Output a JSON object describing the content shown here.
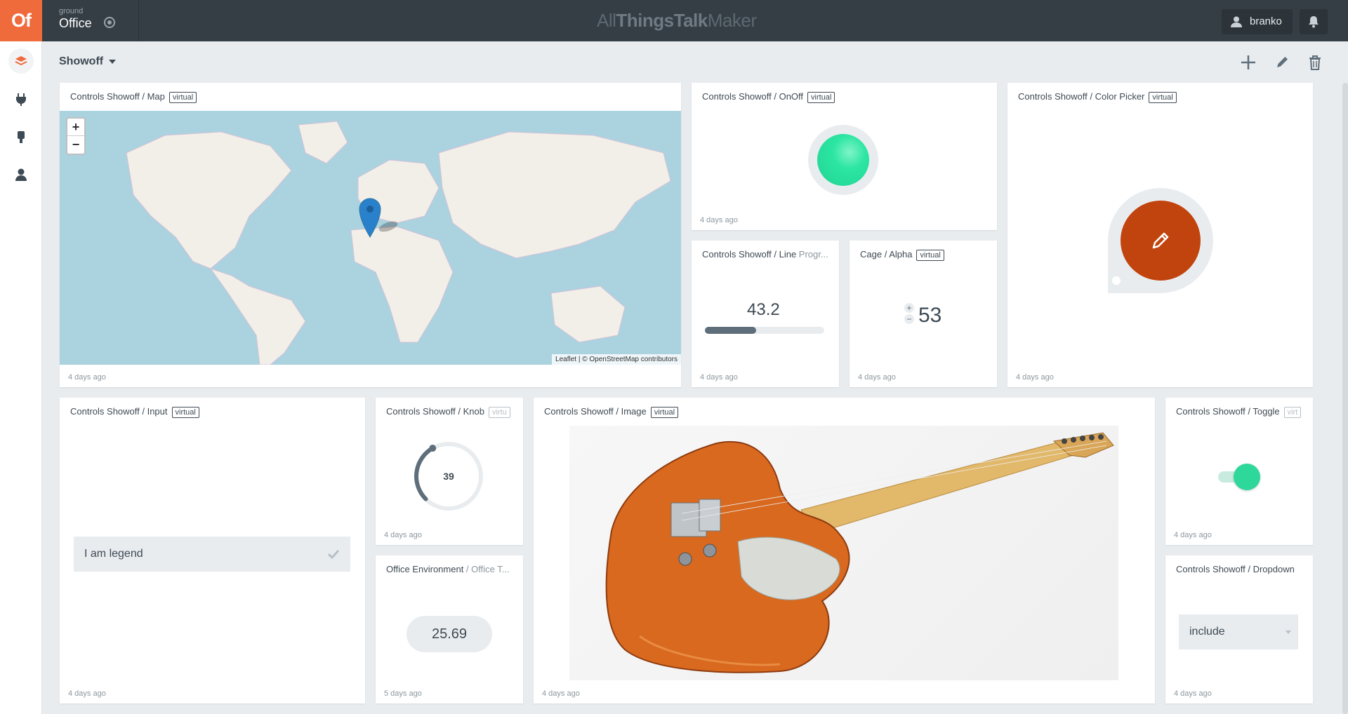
{
  "app": {
    "logo_text": "Of",
    "ground_label": "ground",
    "ground_name": "Office",
    "brand_prefix": "All",
    "brand_bold": "Things",
    "brand_mid": "Talk",
    "brand_suffix": "Maker",
    "user_name": "branko"
  },
  "sidebar": {
    "items": [
      {
        "icon": "layers-icon",
        "active": true
      },
      {
        "icon": "plug-icon",
        "active": false
      },
      {
        "icon": "device-icon",
        "active": false
      },
      {
        "icon": "user-icon",
        "active": false
      }
    ]
  },
  "dashboard": {
    "title": "Showoff",
    "actions": [
      "add-icon",
      "edit-icon",
      "trash-icon"
    ]
  },
  "widgets": {
    "map": {
      "title": "Controls Showoff / Map",
      "tag": "virtual",
      "zoom_in": "+",
      "zoom_out": "−",
      "attribution": "Leaflet | © OpenStreetMap contributors",
      "time": "4 days ago"
    },
    "onoff": {
      "title": "Controls Showoff / OnOff",
      "tag": "virtual",
      "time": "4 days ago",
      "state": true,
      "color": "#2de6a3"
    },
    "colorpicker": {
      "title": "Controls Showoff / Color Picker",
      "tag": "virtual",
      "time": "4 days ago",
      "color": "#c1440e"
    },
    "lineprog": {
      "title_main": "Controls Showoff / Line",
      "title_sec": " Progr...",
      "value": "43.2",
      "progress": 0.432,
      "time": "4 days ago"
    },
    "alpha": {
      "title": "Cage / Alpha",
      "tag": "virtual",
      "value": "53",
      "plus": "+",
      "minus": "−",
      "time": "4 days ago"
    },
    "input": {
      "title": "Controls Showoff / Input",
      "tag": "virtual",
      "value": "I am legend",
      "time": "4 days ago"
    },
    "knob": {
      "title": "Controls Showoff / Knob",
      "tag": "virtu",
      "value": "39",
      "fraction": 0.39,
      "time": "4 days ago"
    },
    "env": {
      "title_main": "Office Environment",
      "title_sec": " / Office T...",
      "value": "25.69",
      "time": "5 days ago"
    },
    "image": {
      "title": "Controls Showoff / Image",
      "tag": "virtual",
      "time": "4 days ago"
    },
    "toggle": {
      "title": "Controls Showoff / Toggle",
      "tag": "virt",
      "state": true,
      "time": "4 days ago"
    },
    "dropdown": {
      "title": "Controls Showoff / Dropdown",
      "value": "include",
      "time": "4 days ago"
    }
  }
}
